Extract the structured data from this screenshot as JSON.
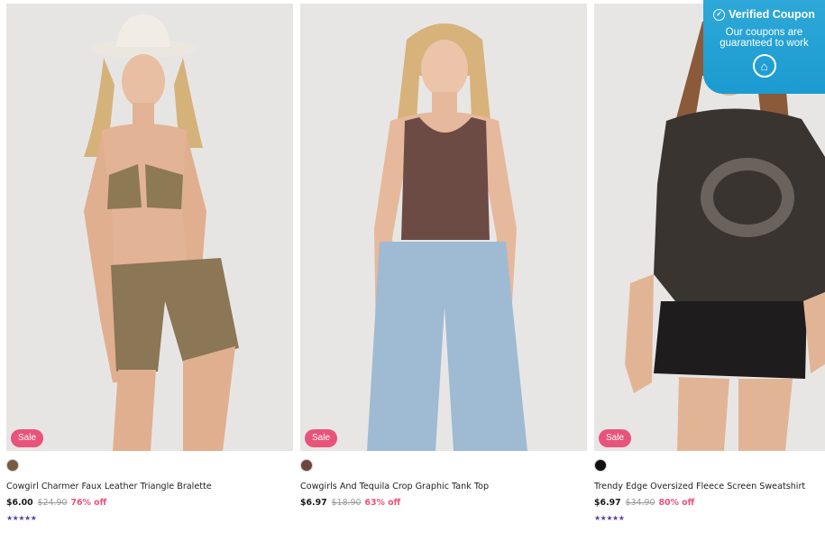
{
  "products": [
    {
      "badge": "Sale",
      "swatch_color": "#7a5a3e",
      "title": "Cowgirl Charmer Faux Leather Triangle Bralette",
      "price": "$6.00",
      "old_price": "$24.90",
      "discount": "76% off",
      "rating": "★★★★★"
    },
    {
      "badge": "Sale",
      "swatch_color": "#6e4640",
      "title": "Cowgirls And Tequila Crop Graphic Tank Top",
      "price": "$6.97",
      "old_price": "$18.90",
      "discount": "63% off",
      "rating": ""
    },
    {
      "badge": "Sale",
      "swatch_color": "#111111",
      "title": "Trendy Edge Oversized Fleece Screen Sweatshirt",
      "price": "$6.97",
      "old_price": "$34.90",
      "discount": "80% off",
      "rating": "★★★★★"
    }
  ],
  "coupon": {
    "title": "Verified Coupon",
    "line1": "Our coupons are",
    "line2": "guaranteed to work"
  },
  "colors": {
    "sale": "#e8537a",
    "stars": "#5b3fa0",
    "coupon_bg": "#1b9bd1"
  }
}
